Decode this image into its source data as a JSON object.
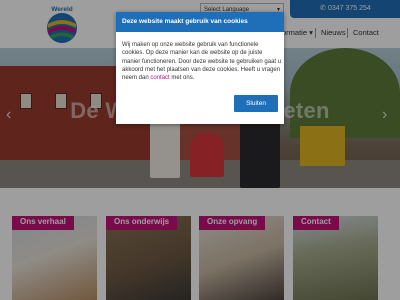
{
  "header": {
    "language": "Select Language",
    "phone_icon": "phone-icon",
    "phone": "0347 375 254",
    "nav": [
      {
        "label": "ormatie ▾"
      },
      {
        "label": "Nieuws"
      },
      {
        "label": "Contact"
      }
    ],
    "logo_text": "Wereld"
  },
  "hero": {
    "title": "De Wereld aan je voeten",
    "prev_icon": "chevron-left-icon",
    "next_icon": "chevron-right-icon"
  },
  "cards": [
    {
      "label": "Ons verhaal"
    },
    {
      "label": "Ons onderwijs"
    },
    {
      "label": "Onze opvang"
    },
    {
      "label": "Contact"
    }
  ],
  "cookie_modal": {
    "title": "Deze website maakt gebruik van cookies",
    "body_before_link": "Wij maken op onze website gebruik van functionele cookies. Op deze manier kan de website op de juiste manier functioneren. Door deze website te gebruiken gaat u akkoord met het plaatsen van deze cookies. Heeft u vragen neem dan ",
    "link": "contact",
    "body_after_link": " met ons.",
    "close_button": "Sluiten"
  },
  "colors": {
    "brand_blue": "#1f6fb8",
    "brand_magenta": "#c4137a"
  }
}
